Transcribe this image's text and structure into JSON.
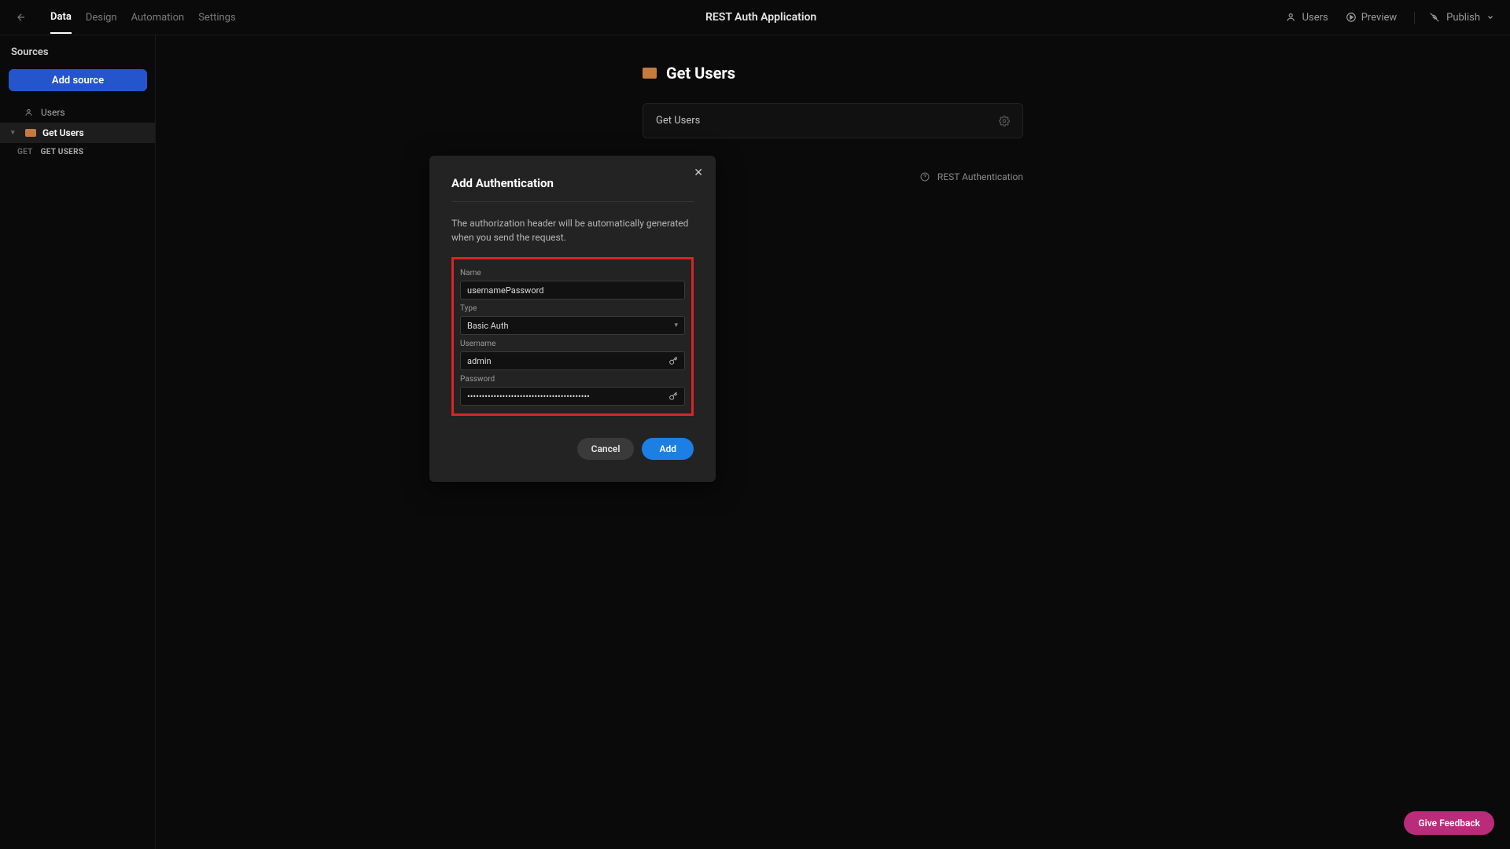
{
  "nav": {
    "tabs": [
      "Data",
      "Design",
      "Automation",
      "Settings"
    ],
    "active": 0,
    "app_title": "REST Auth Application",
    "users": "Users",
    "preview": "Preview",
    "publish": "Publish"
  },
  "sidebar": {
    "title": "Sources",
    "add_source": "Add source",
    "items": [
      {
        "label": "Users",
        "type": "table"
      },
      {
        "label": "Get Users",
        "type": "rest",
        "active": true
      }
    ],
    "sub": {
      "method": "GET",
      "name": "GET USERS"
    }
  },
  "main": {
    "page_title": "Get Users",
    "card_title": "Get Users",
    "rest_auth_label": "REST Authentication"
  },
  "modal": {
    "title": "Add Authentication",
    "description": "The authorization header will be automatically generated when you send the request.",
    "fields": {
      "name_label": "Name",
      "name_value": "usernamePassword",
      "type_label": "Type",
      "type_value": "Basic Auth",
      "username_label": "Username",
      "username_value": "admin",
      "password_label": "Password",
      "password_value": "••••••••••••••••••••••••••••••••••••••••••"
    },
    "cancel": "Cancel",
    "add": "Add"
  },
  "feedback": "Give Feedback"
}
